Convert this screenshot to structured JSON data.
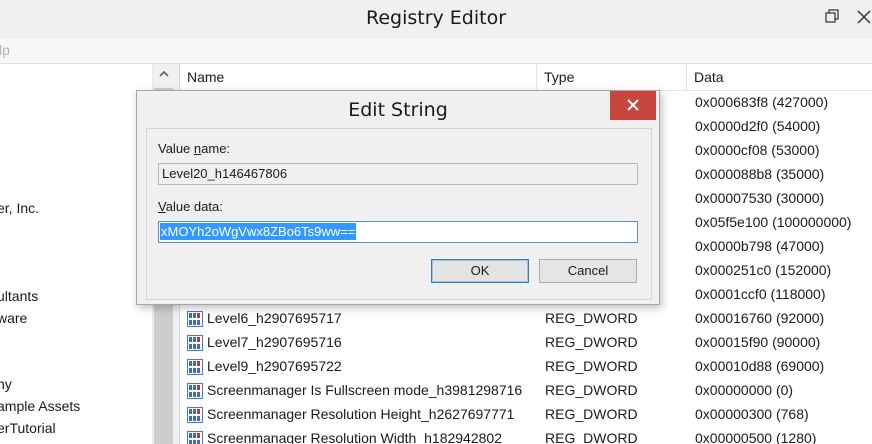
{
  "window": {
    "title": "Registry Editor"
  },
  "menubar": {
    "help_label": "lp"
  },
  "tree": {
    "items": [
      {
        "label": "er, Inc."
      },
      {
        "label": "ultants"
      },
      {
        "label": "ware"
      },
      {
        "label": "ny"
      },
      {
        "label": "ample Assets"
      },
      {
        "label": "erTutorial"
      }
    ]
  },
  "list": {
    "columns": {
      "name": "Name",
      "type": "Type",
      "data": "Data"
    },
    "rows": [
      {
        "name": "",
        "type": "",
        "data": "0x000683f8 (427000)"
      },
      {
        "name": "",
        "type": "",
        "data": "0x0000d2f0 (54000)"
      },
      {
        "name": "",
        "type": "",
        "data": "0x0000cf08 (53000)"
      },
      {
        "name": "",
        "type": "",
        "data": "0x000088b8 (35000)"
      },
      {
        "name": "",
        "type": "",
        "data": "0x00007530 (30000)"
      },
      {
        "name": "",
        "type": "",
        "data": "0x05f5e100 (100000000)"
      },
      {
        "name": "",
        "type": "",
        "data": "0x0000b798 (47000)"
      },
      {
        "name": "",
        "type": "",
        "data": "0x000251c0 (152000)"
      },
      {
        "name": "",
        "type": "",
        "data": "0x0001ccf0 (118000)"
      },
      {
        "name": "Level6_h2907695717",
        "type": "REG_DWORD",
        "data": "0x00016760 (92000)"
      },
      {
        "name": "Level7_h2907695716",
        "type": "REG_DWORD",
        "data": "0x00015f90 (90000)"
      },
      {
        "name": "Level9_h2907695722",
        "type": "REG_DWORD",
        "data": "0x00010d88 (69000)"
      },
      {
        "name": "Screenmanager Is Fullscreen mode_h3981298716",
        "type": "REG_DWORD",
        "data": "0x00000000 (0)"
      },
      {
        "name": "Screenmanager Resolution Height_h2627697771",
        "type": "REG_DWORD",
        "data": "0x00000300 (768)"
      },
      {
        "name": "Screenmanager Resolution Width_h182942802",
        "type": "REG_DWORD",
        "data": "0x00000500 (1280)"
      }
    ]
  },
  "dialog": {
    "title": "Edit String",
    "value_name_label_pre": "Value ",
    "value_name_label_ul": "n",
    "value_name_label_post": "ame:",
    "value_name": "Level20_h146467806",
    "value_data_label_ul": "V",
    "value_data_label_post": "alue data:",
    "value_data": "xMOYh2oWgVwx8ZBo6Ts9ww==",
    "ok_label": "OK",
    "cancel_label": "Cancel"
  },
  "colors": {
    "close_button": "#c7453c",
    "selection": "#3399ff",
    "focus_border": "#5a8fd0"
  },
  "icons": {
    "row_icon": "reg-dword-icon"
  }
}
